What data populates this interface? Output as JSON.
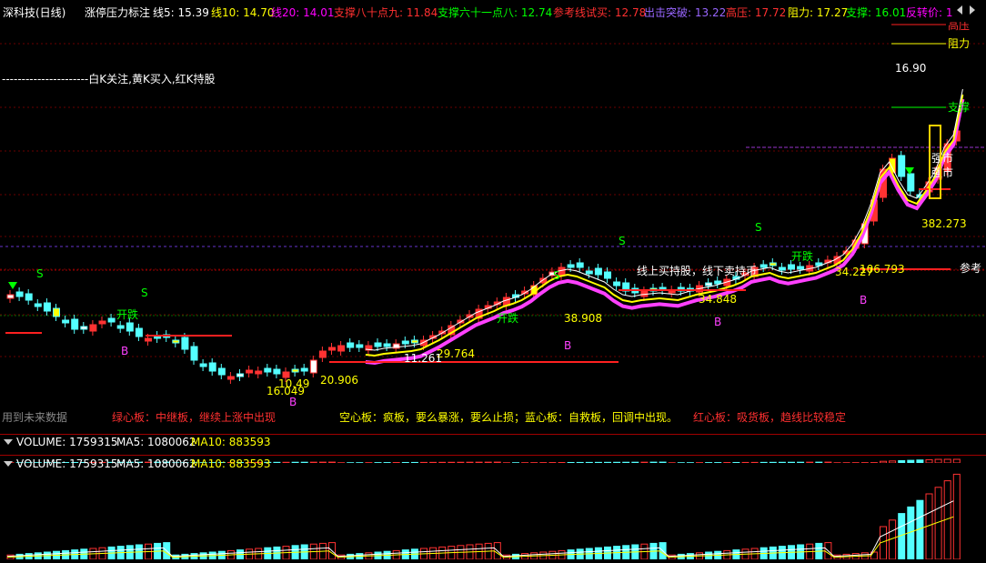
{
  "header": {
    "title": "深科技(日线)",
    "indicator": "涨停压力标注",
    "items": [
      {
        "text": "线5: 15.39",
        "color": "#ffffff"
      },
      {
        "text": "线10: 14.70",
        "color": "#ffff00"
      },
      {
        "text": "线20: 14.01",
        "color": "#ff00ff"
      },
      {
        "text": "支撑八十点九: 11.84",
        "color": "#ff3030"
      },
      {
        "text": "支撑六十一点八: 12.74",
        "color": "#00ff00"
      },
      {
        "text": "参考线试买: 12.78",
        "color": "#ff3030"
      },
      {
        "text": "出击突破: 13.22",
        "color": "#9966ff"
      },
      {
        "text": "高压: 17.72",
        "color": "#ff3030"
      },
      {
        "text": "阻力: 17.27",
        "color": "#ffff00"
      },
      {
        "text": "支撑: 16.01",
        "color": "#00ff00"
      },
      {
        "text": "反转价: 1",
        "color": "#ff00ff"
      }
    ]
  },
  "main": {
    "legend_text": "----------------------白K关注,黄K买入,红K持股",
    "footer_left": "用到未来数据",
    "notes": [
      {
        "text": "绿心板：中继板，继续上涨中出现",
        "color": "#ff3030"
      },
      {
        "text": "空心板：疯板，要么暴涨，要么止损；蓝心板：自救板，回调中出现。",
        "color": "#ffff00"
      },
      {
        "text": "红心板：吸货板，趋线比较稳定",
        "color": "#ff3030"
      }
    ],
    "side_labels": {
      "gaoya": "高压",
      "zuli": "阻力",
      "zhicheng": "支撑",
      "qiangshi": "强市",
      "cankao": "参考"
    },
    "kaidie": "开跌",
    "inline_text": "线上买持股，线下卖持币",
    "price_labels": [
      "16.90",
      "382.273",
      "34.848",
      "38.908",
      "29.764",
      "11.261",
      "20.906",
      "16.049",
      "10.49",
      "106.793",
      "34.227"
    ],
    "marker_s": "S",
    "marker_b": "B"
  },
  "volume1": {
    "label": "VOLUME: 1759315",
    "ma5": "MA5: 1080062",
    "ma10": "MA10: 883593"
  },
  "volume2": {
    "label": "VOLUME: 1759315",
    "ma5": "MA5: 1080062",
    "ma10": "MA10: 883593"
  },
  "colors": {
    "up": "#ff3232",
    "down": "#54ffff",
    "ma5": "#ffffff",
    "ma10": "#ffff00",
    "ma20": "#ff40ff"
  }
}
